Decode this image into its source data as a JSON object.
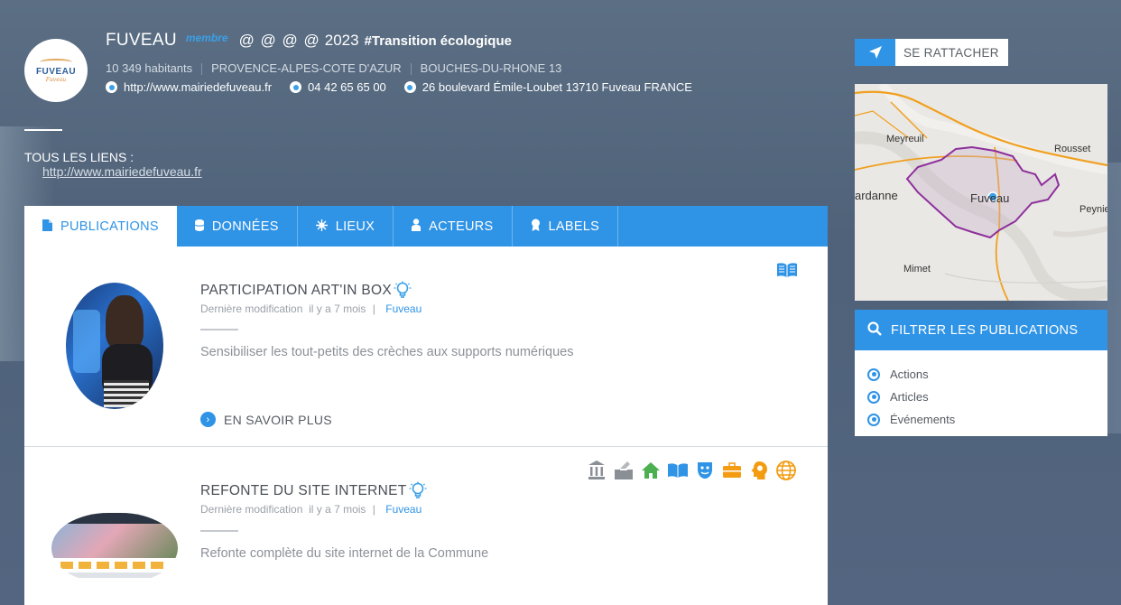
{
  "header": {
    "city": "FUVEAU",
    "member_badge": "membre",
    "ats": "@ @ @ @",
    "year": "2023",
    "hashtag": "#Transition écologique",
    "population": "10 349 habitants",
    "region": "PROVENCE-ALPES-COTE D'AZUR",
    "department": "BOUCHES-DU-RHONE 13",
    "website": "http://www.mairiedefuveau.fr",
    "phone": "04 42 65 65 00",
    "address": "26 boulevard Émile-Loubet 13710 Fuveau FRANCE",
    "logo_text": "FUVEAU",
    "logo_sub": "Fuveau"
  },
  "links": {
    "title": "TOUS LES LIENS :",
    "url": "http://www.mairiedefuveau.fr"
  },
  "tabs": [
    {
      "label": "PUBLICATIONS",
      "icon": "document-icon",
      "active": true
    },
    {
      "label": "DONNÉES",
      "icon": "database-icon",
      "active": false
    },
    {
      "label": "LIEUX",
      "icon": "places-icon",
      "active": false
    },
    {
      "label": "ACTEURS",
      "icon": "user-icon",
      "active": false
    },
    {
      "label": "LABELS",
      "icon": "award-icon",
      "active": false
    }
  ],
  "publications": [
    {
      "title": "PARTICIPATION ART'IN BOX",
      "meta_prefix": "Dernière modification",
      "meta_time": "il y a 7 mois",
      "meta_sep": "|",
      "meta_city": "Fuveau",
      "description": "Sensibiliser les tout-petits des crèches aux supports numériques",
      "more": "EN SAVOIR PLUS"
    },
    {
      "title": "REFONTE DU SITE INTERNET",
      "meta_prefix": "Dernière modification",
      "meta_time": "il y a 7 mois",
      "meta_sep": "|",
      "meta_city": "Fuveau",
      "description": "Refonte complète du site internet de la Commune"
    }
  ],
  "sidebar": {
    "attach_label": "SE RATTACHER",
    "map_labels": {
      "meyreuil": "Meyreuil",
      "rousset": "Rousset",
      "gardanne": "ardanne",
      "fuveau": "Fuveau",
      "peynier": "Peynie",
      "mimet": "Mimet"
    },
    "filter_title": "FILTRER LES PUBLICATIONS",
    "filters": [
      "Actions",
      "Articles",
      "Événements"
    ]
  },
  "colors": {
    "accent": "#2f93e6",
    "background": "#556880",
    "territory": "#8e2f9c",
    "road": "#f0a020"
  }
}
